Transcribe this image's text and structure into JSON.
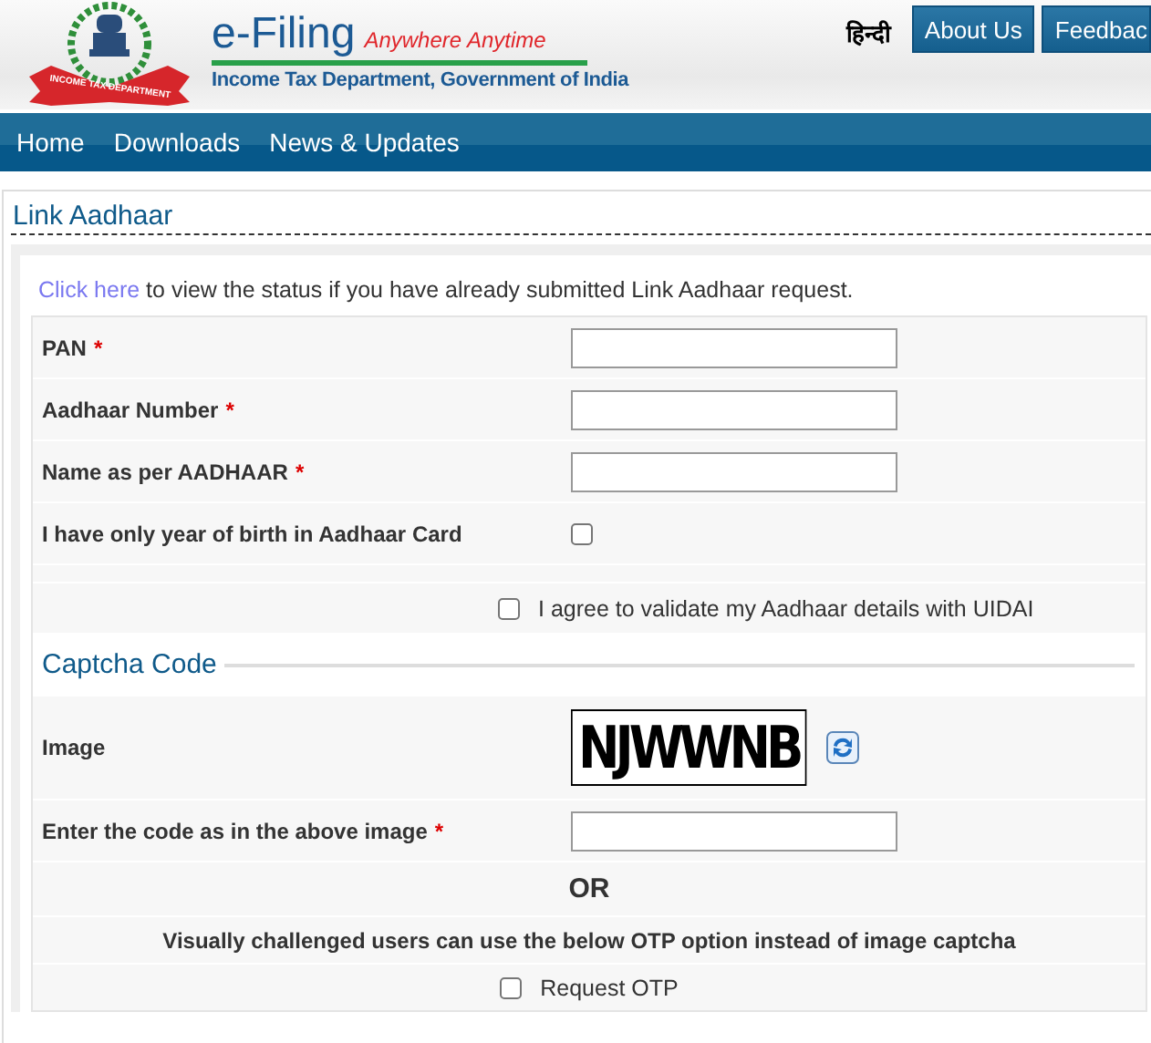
{
  "header": {
    "brand": "e-Filing",
    "tagline": "Anywhere Anytime",
    "subtitle": "Income Tax Department, Government of India",
    "ribbon": "INCOME TAX DEPARTMENT",
    "language_link": "हिन्दी",
    "top_buttons": [
      "About Us",
      "Feedbac"
    ]
  },
  "nav": [
    "Home",
    "Downloads",
    "News & Updates"
  ],
  "page_title": "Link Aadhaar",
  "status_note": {
    "link": "Click here",
    "text": " to view the status if you have already submitted Link Aadhaar request."
  },
  "fields": [
    {
      "label": "PAN",
      "required_mark": "*",
      "kind": "text"
    },
    {
      "label": "Aadhaar Number",
      "required_mark": "*",
      "kind": "text"
    },
    {
      "label": "Name as per AADHAAR",
      "required_mark": "*",
      "kind": "text"
    },
    {
      "label": "I have only year of birth in Aadhaar Card",
      "kind": "checkbox",
      "checked": false
    }
  ],
  "consent": {
    "label": "I agree to validate my Aadhaar details with UIDAI",
    "checked": false
  },
  "captcha": {
    "legend": "Captcha Code",
    "image_label": "Image",
    "image_text": "NJWWNB",
    "code_label": "Enter the code as in the above image",
    "code_required_mark": "*"
  },
  "or_text": "OR",
  "otp_note": "Visually challenged users can use the below OTP option instead of image captcha",
  "otp": {
    "label": "Request OTP",
    "checked": false
  }
}
